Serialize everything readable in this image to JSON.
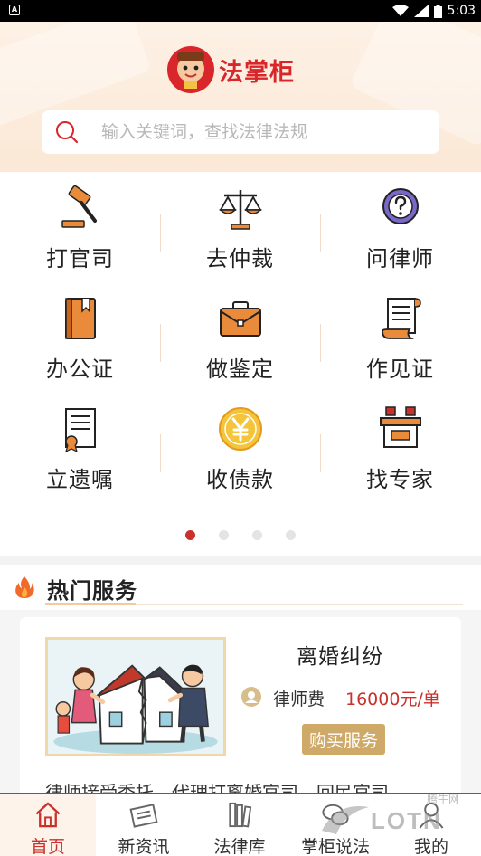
{
  "status_bar": {
    "time": "5:03",
    "notification_glyph": "A"
  },
  "header": {
    "logo_text": "法掌柜",
    "search_placeholder": "输入关键词，查找法律法规"
  },
  "services": [
    {
      "label": "打官司",
      "icon": "gavel-icon"
    },
    {
      "label": "去仲裁",
      "icon": "scales-icon"
    },
    {
      "label": "问律师",
      "icon": "question-icon"
    },
    {
      "label": "办公证",
      "icon": "book-icon"
    },
    {
      "label": "做鉴定",
      "icon": "briefcase-icon"
    },
    {
      "label": "作见证",
      "icon": "scroll-icon"
    },
    {
      "label": "立遗嘱",
      "icon": "certificate-icon"
    },
    {
      "label": "收债款",
      "icon": "yen-coin-icon"
    },
    {
      "label": "找专家",
      "icon": "podium-icon"
    }
  ],
  "pager": {
    "count": 4,
    "active": 0
  },
  "hot_services": {
    "title": "热门服务",
    "card": {
      "title": "离婚纠纷",
      "fee_label": "律师费",
      "fee_value": "16000元/单",
      "buy_label": "购买服务",
      "description": "律师接受委托，代理打离婚官司，回民官司"
    }
  },
  "tabbar": {
    "active": 0,
    "tabs": [
      {
        "label": "首页",
        "icon": "home-icon"
      },
      {
        "label": "新资讯",
        "icon": "news-icon"
      },
      {
        "label": "法律库",
        "icon": "books-icon"
      },
      {
        "label": "掌柜说法",
        "icon": "chat-icon"
      },
      {
        "label": "我的",
        "icon": "user-icon"
      }
    ]
  },
  "watermark": {
    "text": "LOTN",
    "small": "腾牛网"
  },
  "colors": {
    "accent": "#c8312c",
    "gold": "#cfa968",
    "header_bg": "#fbe8d6"
  }
}
